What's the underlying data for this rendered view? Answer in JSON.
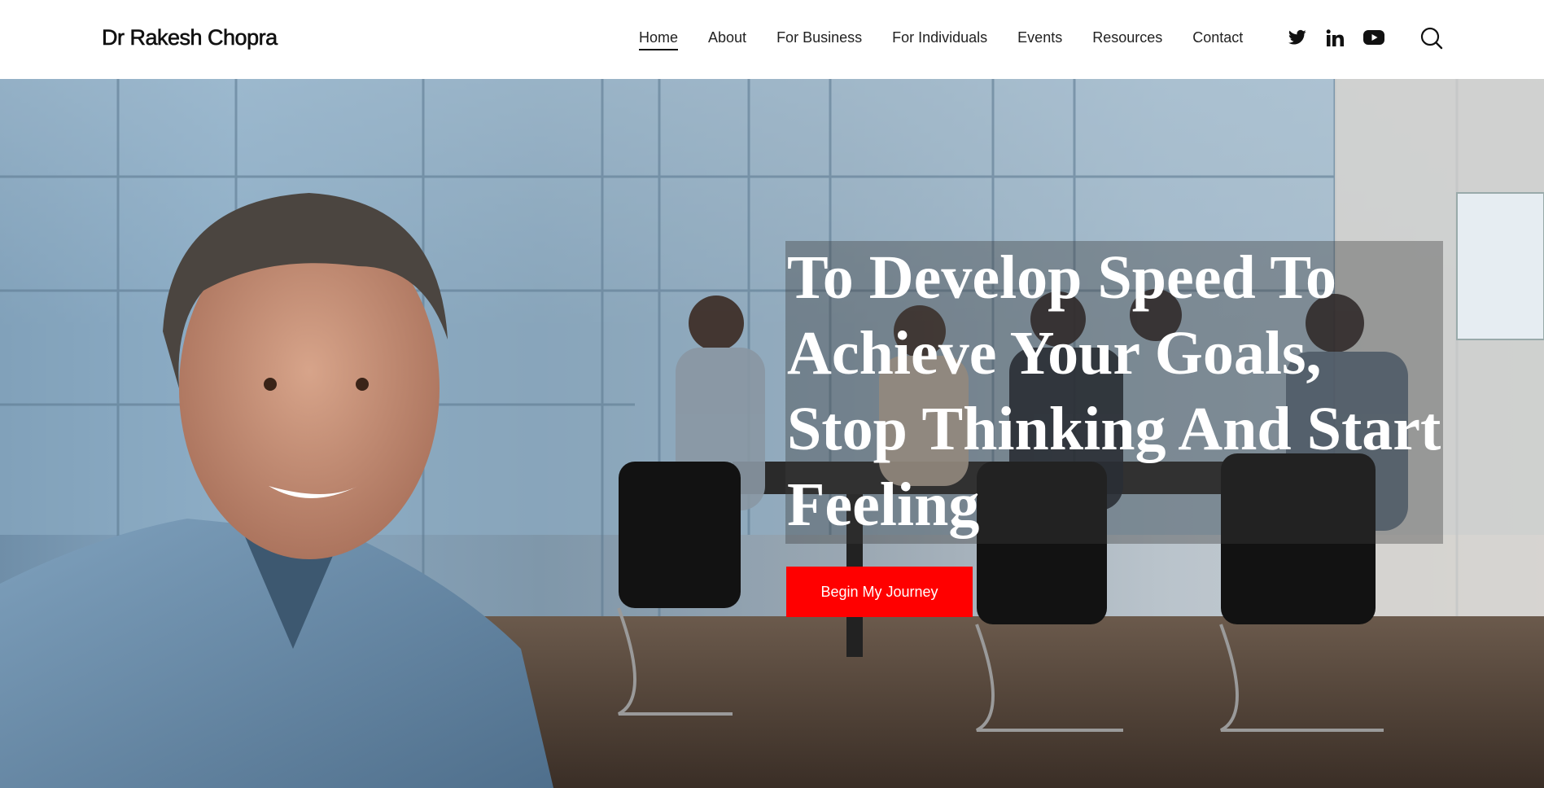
{
  "header": {
    "brand": "Dr Rakesh Chopra",
    "nav": [
      {
        "label": "Home",
        "active": true
      },
      {
        "label": "About",
        "active": false
      },
      {
        "label": "For Business",
        "active": false
      },
      {
        "label": "For Individuals",
        "active": false
      },
      {
        "label": "Events",
        "active": false
      },
      {
        "label": "Resources",
        "active": false
      },
      {
        "label": "Contact",
        "active": false
      }
    ],
    "social_icons": [
      "twitter-icon",
      "linkedin-icon",
      "youtube-icon"
    ],
    "search_icon": "search-icon"
  },
  "hero": {
    "headline": "To Develop Speed To Achieve Your Goals, Stop Thinking And Start Feeling",
    "cta_label": "Begin My Journey",
    "background_image": "office meeting room with portrait of a smiling man in a blue shirt"
  },
  "colors": {
    "accent": "#ff0000",
    "text": "#111111",
    "headline_text": "#ffffff"
  }
}
